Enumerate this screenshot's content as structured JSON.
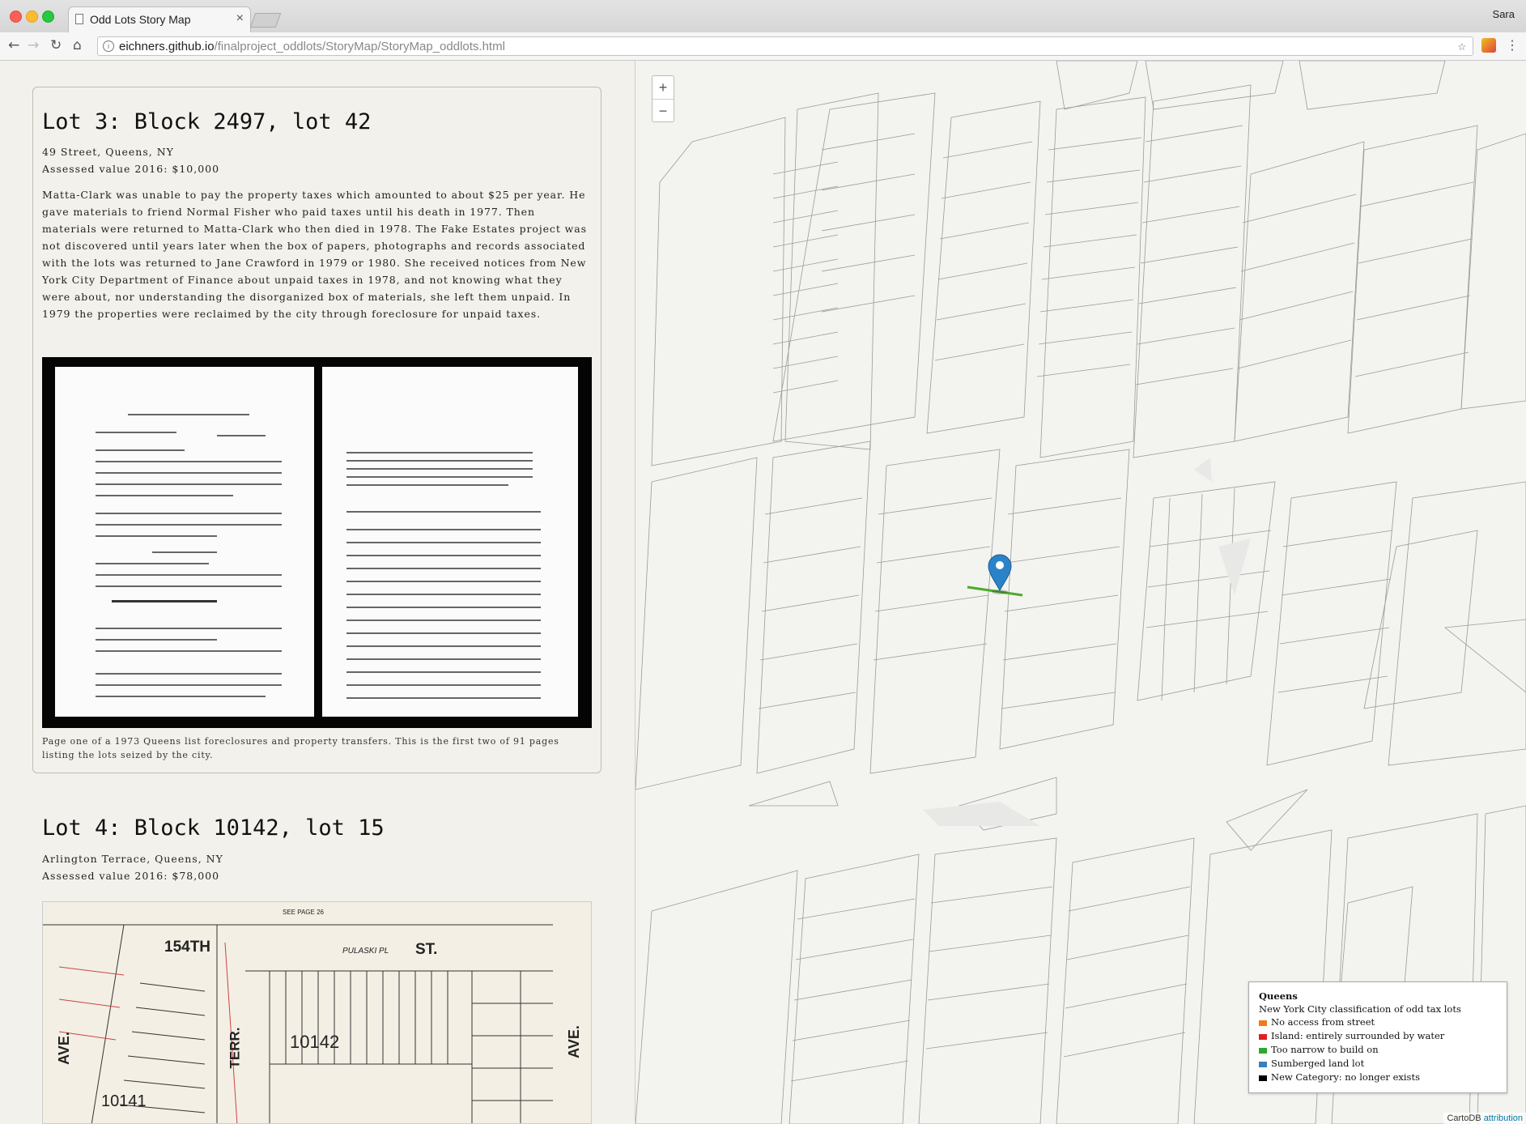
{
  "browser": {
    "tab_title": "Odd Lots Story Map",
    "tab_close": "×",
    "user": "Sara",
    "url_domain": "eichners.github.io",
    "url_path": "/finalproject_oddlots/StoryMap/StoryMap_oddlots.html",
    "back": "←",
    "forward": "→",
    "reload": "↻",
    "home": "⌂",
    "star": "☆",
    "menu": "⋮"
  },
  "lot3": {
    "title": "Lot 3: Block 2497, lot 42",
    "address": "49 Street, Queens, NY",
    "assessed": "Assessed value 2016: $10,000",
    "description": "Matta-Clark was unable to pay the property taxes which amounted to about $25 per year. He gave materials to friend Normal Fisher who paid taxes until his death in 1977. Then materials were returned to Matta-Clark who then died in 1978. The Fake Estates project was not discovered until years later when the box of papers, photographs and records associated with the lots was returned to Jane Crawford in 1979 or 1980. She received notices from New York City Department of Finance about unpaid taxes in 1978, and not knowing what they were about, nor understanding the disorganized box of materials, she left them unpaid. In 1979 the properties were reclaimed by the city through foreclosure for unpaid taxes.",
    "caption": "Page one of a 1973 Queens list foreclosures and property transfers. This is the first two of 91 pages listing the lots seized by the city."
  },
  "lot4": {
    "title": "Lot 4: Block 10142, lot 15",
    "address": "Arlington Terrace, Queens, NY",
    "assessed": "Assessed value 2016: $78,000",
    "plat_labels": {
      "street_154": "154TH",
      "pulaski": "PULASKI  PL",
      "st": "ST.",
      "block_10142": "10142",
      "block_10141": "10141",
      "ave_left": "AVE.",
      "ave_right": "AVE.",
      "terr": "TERR.",
      "see_page": "SEE PAGE 26"
    }
  },
  "map": {
    "zoom_in": "+",
    "zoom_out": "−",
    "legend": {
      "title": "Queens",
      "subtitle": "New York City classification of odd tax lots",
      "items": [
        {
          "label": "No access from street",
          "color": "#f07a1a"
        },
        {
          "label": "Island: entirely surrounded by water",
          "color": "#e02020"
        },
        {
          "label": "Too narrow to build on",
          "color": "#2ea82e"
        },
        {
          "label": "Sumberged land lot",
          "color": "#3a7fc0"
        },
        {
          "label": "New Category: no longer exists",
          "color": "#000000"
        }
      ]
    },
    "attribution_prefix": "CartoDB",
    "attribution_link": "attribution",
    "marker_color": "#2a83c9"
  }
}
